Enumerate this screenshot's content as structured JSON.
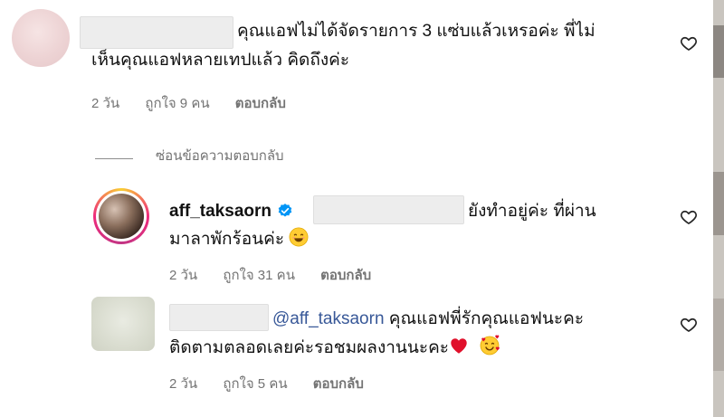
{
  "comments": [
    {
      "line1": "คุณแอฟไม่ได้จัดรายการ 3 แซ่บแล้วเหรอค่ะ พี่ไม่",
      "line2": "เห็นคุณแอฟหลายเทปแล้ว คิดถึงค่ะ",
      "time": "2 วัน",
      "likes": "ถูกใจ 9 คน",
      "reply": "ตอบกลับ"
    }
  ],
  "hide_replies": "ซ่อนข้อความตอบกลับ",
  "reply_comment": {
    "username": "aff_taksaorn",
    "line1": "ยังทำอยู่ค่ะ ที่ผ่าน",
    "line2": "มาลาพักร้อนค่ะ",
    "time": "2 วัน",
    "likes": "ถูกใจ 31 คน",
    "reply": "ตอบกลับ"
  },
  "third_comment": {
    "mention": "@aff_taksaorn",
    "line1": "คุณแอฟพี่รักคุณแอฟนะคะ",
    "line2": "ติดตามตลอดเลยค่ะรอชมผลงานนะคะ",
    "time": "2 วัน",
    "likes": "ถูกใจ 5 คน",
    "reply": "ตอบกลับ"
  },
  "icons": {
    "like": "heart-outline-icon",
    "verified": "verified-badge-icon",
    "smile": "smiling-face-emoji",
    "red_heart": "red-heart-emoji",
    "hearts_face": "smiling-face-with-hearts-emoji"
  },
  "colors": {
    "text": "#111111",
    "meta": "#737373",
    "mention": "#385898",
    "verified": "#0095f6"
  }
}
